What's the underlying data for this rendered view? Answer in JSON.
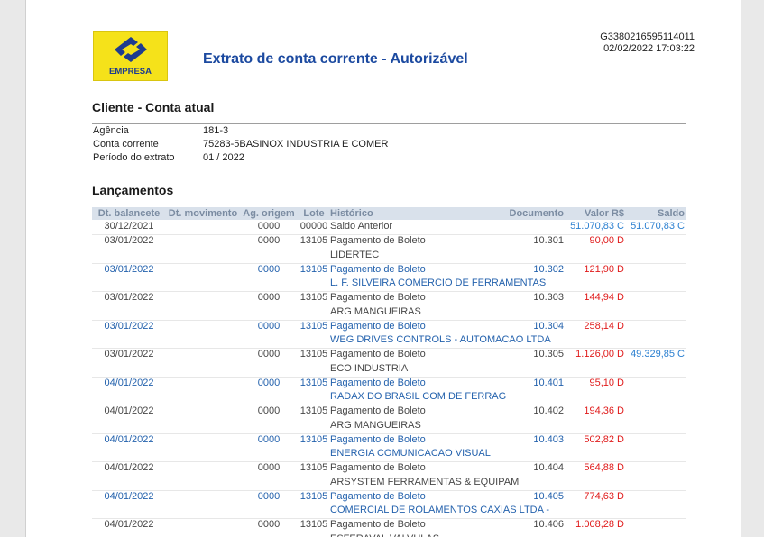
{
  "header": {
    "logo_text": "EMPRESA",
    "logo_icon": "banco-do-brasil-logo",
    "title": "Extrato de conta corrente - Autorizável",
    "code": "G3380216595114011",
    "datetime": "02/02/2022 17:03:22"
  },
  "cliente": {
    "heading": "Cliente - Conta atual",
    "fields": [
      {
        "label": "Agência",
        "value": "181-3"
      },
      {
        "label": "Conta corrente",
        "value": "75283-5BASINOX INDUSTRIA E COMER"
      },
      {
        "label": "Período do extrato",
        "value": "01 / 2022"
      }
    ]
  },
  "lancamentos": {
    "heading": "Lançamentos",
    "columns": {
      "dt_balancete": "Dt. balancete",
      "dt_movimento": "Dt. movimento",
      "ag_origem": "Ag. origem",
      "lote": "Lote",
      "historico": "Histórico",
      "documento": "Documento",
      "valor": "Valor R$",
      "saldo": "Saldo"
    },
    "rows": [
      {
        "dt_balancete": "30/12/2021",
        "ag_origem": "0000",
        "lote": "00000",
        "historico": "Saldo Anterior",
        "valor": "51.070,83 C",
        "saldo": "51.070,83 C",
        "tone": "gray"
      },
      {
        "dt_balancete": "03/01/2022",
        "ag_origem": "0000",
        "lote": "13105",
        "historico": "Pagamento de Boleto",
        "documento": "10.301",
        "valor": "90,00 D",
        "detalhe": "LIDERTEC",
        "tone": "gray"
      },
      {
        "dt_balancete": "03/01/2022",
        "ag_origem": "0000",
        "lote": "13105",
        "historico": "Pagamento de Boleto",
        "documento": "10.302",
        "valor": "121,90 D",
        "detalhe": "L. F. SILVEIRA COMERCIO DE FERRAMENTAS",
        "tone": "blue"
      },
      {
        "dt_balancete": "03/01/2022",
        "ag_origem": "0000",
        "lote": "13105",
        "historico": "Pagamento de Boleto",
        "documento": "10.303",
        "valor": "144,94 D",
        "detalhe": "ARG MANGUEIRAS",
        "tone": "gray"
      },
      {
        "dt_balancete": "03/01/2022",
        "ag_origem": "0000",
        "lote": "13105",
        "historico": "Pagamento de Boleto",
        "documento": "10.304",
        "valor": "258,14 D",
        "detalhe": "WEG DRIVES CONTROLS - AUTOMACAO LTDA",
        "tone": "blue"
      },
      {
        "dt_balancete": "03/01/2022",
        "ag_origem": "0000",
        "lote": "13105",
        "historico": "Pagamento de Boleto",
        "documento": "10.305",
        "valor": "1.126,00 D",
        "saldo": "49.329,85 C",
        "detalhe": "ECO INDUSTRIA",
        "tone": "gray"
      },
      {
        "dt_balancete": "04/01/2022",
        "ag_origem": "0000",
        "lote": "13105",
        "historico": "Pagamento de Boleto",
        "documento": "10.401",
        "valor": "95,10 D",
        "detalhe": "RADAX DO BRASIL COM DE FERRAG",
        "tone": "blue"
      },
      {
        "dt_balancete": "04/01/2022",
        "ag_origem": "0000",
        "lote": "13105",
        "historico": "Pagamento de Boleto",
        "documento": "10.402",
        "valor": "194,36 D",
        "detalhe": "ARG MANGUEIRAS",
        "tone": "gray"
      },
      {
        "dt_balancete": "04/01/2022",
        "ag_origem": "0000",
        "lote": "13105",
        "historico": "Pagamento de Boleto",
        "documento": "10.403",
        "valor": "502,82 D",
        "detalhe": "ENERGIA COMUNICACAO VISUAL",
        "tone": "blue"
      },
      {
        "dt_balancete": "04/01/2022",
        "ag_origem": "0000",
        "lote": "13105",
        "historico": "Pagamento de Boleto",
        "documento": "10.404",
        "valor": "564,88 D",
        "detalhe": "ARSYSTEM FERRAMENTAS & EQUIPAM",
        "tone": "gray"
      },
      {
        "dt_balancete": "04/01/2022",
        "ag_origem": "0000",
        "lote": "13105",
        "historico": "Pagamento de Boleto",
        "documento": "10.405",
        "valor": "774,63 D",
        "detalhe": "COMERCIAL DE ROLAMENTOS CAXIAS LTDA -",
        "tone": "blue"
      },
      {
        "dt_balancete": "04/01/2022",
        "ag_origem": "0000",
        "lote": "13105",
        "historico": "Pagamento de Boleto",
        "documento": "10.406",
        "valor": "1.008,28 D",
        "detalhe": "ESFERAVAL VALVULAS",
        "tone": "gray"
      }
    ]
  },
  "colors": {
    "title": "#1c4aa0",
    "text_gray": "#474747",
    "text_blue": "#2462ad",
    "debit": "#e01b1b",
    "credit": "#2a7fd0",
    "header_bg": "#d9e1eb",
    "header_text": "#7b8ca2",
    "logo_yellow": "#f5e21a",
    "logo_blue": "#1e3c8f"
  }
}
